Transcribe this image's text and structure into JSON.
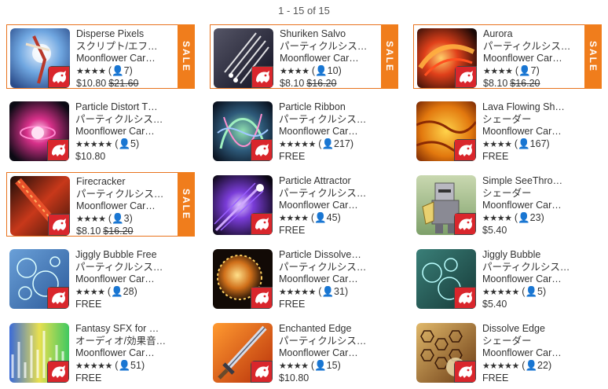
{
  "pagination": "1 - 15 of 15",
  "sale_label": "SALE",
  "colors": {
    "sale_accent": "#f07d1c",
    "sale_border": "#e8731e",
    "publisher_badge": "#d9262c"
  },
  "items": [
    {
      "title": "Disperse Pixels",
      "category": "スクリプト/エフ…",
      "publisher": "Moonflower Car…",
      "stars": "★★★★",
      "count": "7",
      "price": "$10.80",
      "old_price": "$21.60",
      "sale": true,
      "thumb_icon": "dancer-thumbnail"
    },
    {
      "title": "Shuriken Salvo",
      "category": "パーティクルシス…",
      "publisher": "Moonflower Car…",
      "stars": "★★★★",
      "count": "10",
      "price": "$8.10",
      "old_price": "$16.20",
      "sale": true,
      "thumb_icon": "streaks-thumbnail"
    },
    {
      "title": "Aurora",
      "category": "パーティクルシス…",
      "publisher": "Moonflower Car…",
      "stars": "★★★★",
      "count": "7",
      "price": "$8.10",
      "old_price": "$16.20",
      "sale": true,
      "thumb_icon": "aurora-thumbnail"
    },
    {
      "title": "Particle Distort T…",
      "category": "パーティクルシス…",
      "publisher": "Moonflower Car…",
      "stars": "★★★★★",
      "count": "5",
      "price": "$10.80",
      "old_price": "",
      "sale": false,
      "thumb_icon": "distort-thumbnail"
    },
    {
      "title": "Particle Ribbon",
      "category": "パーティクルシス…",
      "publisher": "Moonflower Car…",
      "stars": "★★★★★",
      "count": "217",
      "price": "FREE",
      "old_price": "",
      "sale": false,
      "thumb_icon": "ribbon-thumbnail"
    },
    {
      "title": "Lava Flowing Sh…",
      "category": "シェーダー",
      "publisher": "Moonflower Car…",
      "stars": "★★★★",
      "count": "167",
      "price": "FREE",
      "old_price": "",
      "sale": false,
      "thumb_icon": "lava-thumbnail"
    },
    {
      "title": "Firecracker",
      "category": "パーティクルシス…",
      "publisher": "Moonflower Car…",
      "stars": "★★★★",
      "count": "3",
      "price": "$8.10",
      "old_price": "$16.20",
      "sale": true,
      "thumb_icon": "firecracker-thumbnail"
    },
    {
      "title": "Particle Attractor",
      "category": "パーティクルシス…",
      "publisher": "Moonflower Car…",
      "stars": "★★★★",
      "count": "45",
      "price": "FREE",
      "old_price": "",
      "sale": false,
      "thumb_icon": "attractor-thumbnail"
    },
    {
      "title": "Simple SeeThro…",
      "category": "シェーダー",
      "publisher": "Moonflower Car…",
      "stars": "★★★★",
      "count": "23",
      "price": "$5.40",
      "old_price": "",
      "sale": false,
      "thumb_icon": "knight-thumbnail"
    },
    {
      "title": "Jiggly Bubble Free",
      "category": "パーティクルシス…",
      "publisher": "Moonflower Car…",
      "stars": "★★★★",
      "count": "28",
      "price": "FREE",
      "old_price": "",
      "sale": false,
      "thumb_icon": "bubbles-thumbnail"
    },
    {
      "title": "Particle Dissolve…",
      "category": "パーティクルシス…",
      "publisher": "Moonflower Car…",
      "stars": "★★★★★",
      "count": "31",
      "price": "FREE",
      "old_price": "",
      "sale": false,
      "thumb_icon": "dissolve-thumbnail"
    },
    {
      "title": "Jiggly Bubble",
      "category": "パーティクルシス…",
      "publisher": "Moonflower Car…",
      "stars": "★★★★★",
      "count": "5",
      "price": "$5.40",
      "old_price": "",
      "sale": false,
      "thumb_icon": "teal-bubbles-thumbnail"
    },
    {
      "title": "Fantasy SFX for …",
      "category": "オーディオ/効果音…",
      "publisher": "Moonflower Car…",
      "stars": "★★★★★",
      "count": "51",
      "price": "FREE",
      "old_price": "",
      "sale": false,
      "thumb_icon": "sfx-thumbnail"
    },
    {
      "title": "Enchanted Edge",
      "category": "パーティクルシス…",
      "publisher": "Moonflower Car…",
      "stars": "★★★★",
      "count": "15",
      "price": "$10.80",
      "old_price": "",
      "sale": false,
      "thumb_icon": "sword-thumbnail"
    },
    {
      "title": "Dissolve Edge",
      "category": "シェーダー",
      "publisher": "Moonflower Car…",
      "stars": "★★★★★",
      "count": "22",
      "price": "FREE",
      "old_price": "",
      "sale": false,
      "thumb_icon": "hex-dissolve-thumbnail"
    }
  ]
}
